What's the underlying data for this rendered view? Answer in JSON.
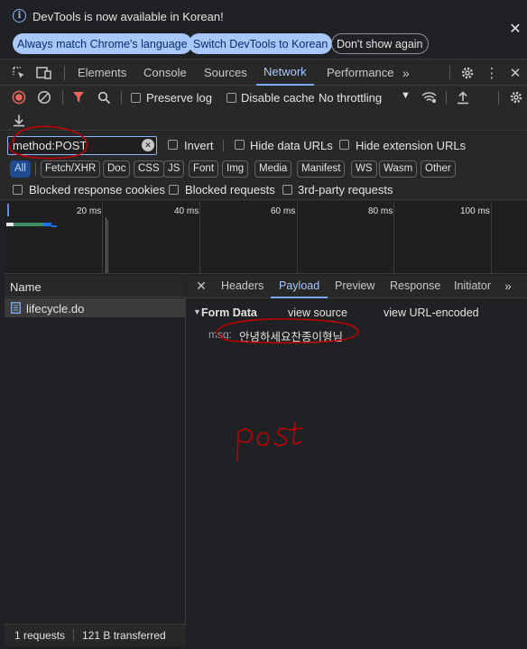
{
  "infobar": {
    "message": "DevTools is now available in Korean!",
    "buttons": [
      "Always match Chrome's language",
      "Switch DevTools to Korean",
      "Don't show again"
    ]
  },
  "main_tabs": [
    "Elements",
    "Console",
    "Sources",
    "Network",
    "Performance"
  ],
  "toolbar": {
    "preserve_log": "Preserve log",
    "disable_cache": "Disable cache",
    "throttling": "No throttling"
  },
  "filter": {
    "value": "method:POST",
    "invert": "Invert",
    "hide_data_urls": "Hide data URLs",
    "hide_extension_urls": "Hide extension URLs"
  },
  "type_filters": [
    "All",
    "Fetch/XHR",
    "Doc",
    "CSS",
    "JS",
    "Font",
    "Img",
    "Media",
    "Manifest",
    "WS",
    "Wasm",
    "Other"
  ],
  "block_filters": [
    "Blocked response cookies",
    "Blocked requests",
    "3rd-party requests"
  ],
  "overview": {
    "ticks": [
      "20 ms",
      "40 ms",
      "60 ms",
      "80 ms",
      "100 ms"
    ]
  },
  "requests": {
    "column": "Name",
    "rows": [
      {
        "name": "lifecycle.do"
      }
    ],
    "status": {
      "count": "1 requests",
      "transferred": "121 B transferred"
    }
  },
  "detail": {
    "tabs": [
      "Headers",
      "Payload",
      "Preview",
      "Response",
      "Initiator"
    ],
    "section_title": "Form Data",
    "view_source": "view source",
    "view_url_encoded": "view URL-encoded",
    "field_key": "msg:",
    "field_value": "안녕하세요찬종이형님"
  },
  "annotation": {
    "text": "post",
    "color": "#c00000"
  },
  "colors": {
    "accent": "#a8c7fa",
    "record": "#ee675c",
    "filter": "#ee675c"
  }
}
